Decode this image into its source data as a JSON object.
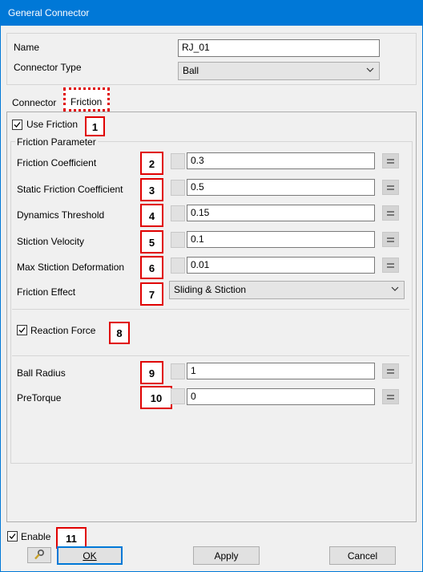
{
  "window": {
    "title": "General Connector"
  },
  "header": {
    "name_label": "Name",
    "name_value": "RJ_01",
    "connector_type_label": "Connector Type",
    "connector_type_value": "Ball"
  },
  "tabs": [
    {
      "label": "Connector",
      "active": false
    },
    {
      "label": "Friction",
      "active": true
    }
  ],
  "friction": {
    "use_friction_label": "Use Friction",
    "use_friction_checked": true,
    "parameter_group_label": "Friction Parameter",
    "rows": [
      {
        "label": "Friction Coefficient",
        "value": "0.3",
        "badge": "2"
      },
      {
        "label": "Static Friction Coefficient",
        "value": "0.5",
        "badge": "3"
      },
      {
        "label": "Dynamics Threshold",
        "value": "0.15",
        "badge": "4"
      },
      {
        "label": "Stiction Velocity",
        "value": "0.1",
        "badge": "5"
      },
      {
        "label": "Max Stiction Deformation",
        "value": "0.01",
        "badge": "6"
      }
    ],
    "effect_label": "Friction Effect",
    "effect_value": "Sliding & Stiction",
    "effect_badge": "7",
    "reaction_force_label": "Reaction Force",
    "reaction_force_checked": true,
    "reaction_force_badge": "8",
    "ball_rows": [
      {
        "label": "Ball Radius",
        "value": "1",
        "badge": "9"
      },
      {
        "label": "PreTorque",
        "value": "0",
        "badge": "10"
      }
    ],
    "use_friction_badge": "1"
  },
  "footer": {
    "enable_label": "Enable",
    "enable_checked": true,
    "enable_badge": "11",
    "ok_label": "OK",
    "apply_label": "Apply",
    "cancel_label": "Cancel"
  },
  "colors": {
    "titlebar": "#0078d7",
    "badge_border": "#e00000",
    "default_button_border": "#0078d7"
  },
  "icons": {
    "chevron": "chevron-down-icon",
    "check": "checkmark-icon",
    "tool": "wrench-icon"
  }
}
